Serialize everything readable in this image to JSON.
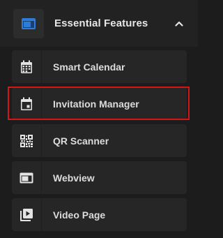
{
  "header": {
    "title": "Essential Features",
    "icon": "webview-icon",
    "chevron": "chevron-up-icon",
    "accent": "#2f7bd8"
  },
  "items": [
    {
      "label": "Smart Calendar",
      "icon": "calendar-grid-icon"
    },
    {
      "label": "Invitation Manager",
      "icon": "calendar-event-icon",
      "highlighted": true
    },
    {
      "label": "QR Scanner",
      "icon": "qr-code-icon"
    },
    {
      "label": "Webview",
      "icon": "webview-icon"
    },
    {
      "label": "Video Page",
      "icon": "video-library-icon"
    }
  ],
  "highlight_color": "#d01818"
}
